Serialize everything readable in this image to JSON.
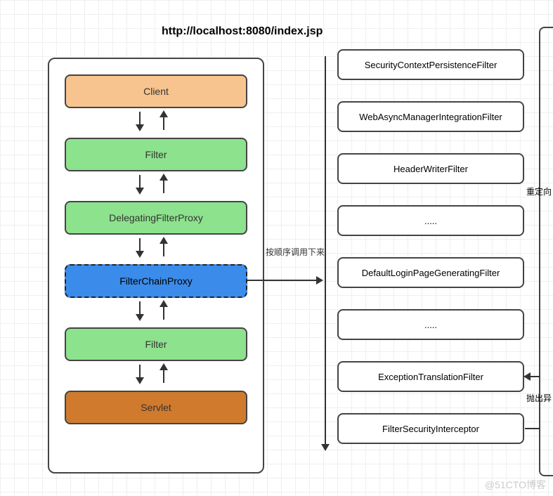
{
  "title": "http://localhost:8080/index.jsp",
  "left": {
    "client": "Client",
    "filter1": "Filter",
    "dfp": "DelegatingFilterProxy",
    "fcp": "FilterChainProxy",
    "filter2": "Filter",
    "servlet": "Servlet"
  },
  "connector_label": "按顺序调用下来",
  "right": {
    "items": [
      "SecurityContextPersistenceFilter",
      "WebAsyncManagerIntegrationFilter",
      "HeaderWriterFilter",
      ".....",
      "DefaultLoginPageGeneratingFilter",
      ".....",
      "ExceptionTranslationFilter",
      "FilterSecurityInterceptor"
    ]
  },
  "side_labels": {
    "redirect": "重定向",
    "throw": "抛出异"
  },
  "watermark": "@51CTO博客"
}
